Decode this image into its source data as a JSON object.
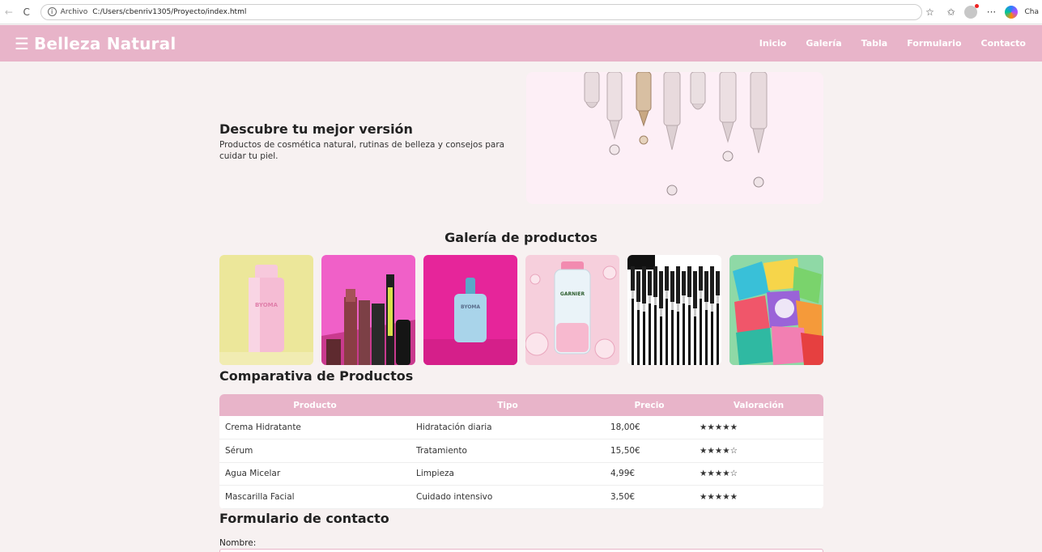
{
  "browser": {
    "scheme_label": "Archivo",
    "url": "C:/Users/cbenriv1305/Proyecto/index.html",
    "copilot_label": "Cha"
  },
  "header": {
    "brand": "Belleza Natural",
    "nav": [
      "Inicio",
      "Galería",
      "Tabla",
      "Formulario",
      "Contacto"
    ]
  },
  "hero": {
    "title": "Descubre tu mejor versión",
    "description": "Productos de cosmética natural, rutinas de belleza y consejos para cuidar tu piel."
  },
  "gallery": {
    "title": "Galería de productos",
    "items": [
      {
        "label": "BYOMA",
        "bg": "#ece79a"
      },
      {
        "label": "",
        "bg": "#f060c8"
      },
      {
        "label": "BYOMA",
        "bg": "#e6259a"
      },
      {
        "label": "GARNIER",
        "bg": "#f6cfdc"
      },
      {
        "label": "",
        "bg": "#ffffff"
      },
      {
        "label": "",
        "bg": "#6ed0c9"
      }
    ]
  },
  "table": {
    "title": "Comparativa de Productos",
    "headers": [
      "Producto",
      "Tipo",
      "Precio",
      "Valoración"
    ],
    "rows": [
      [
        "Crema Hidratante",
        "Hidratación diaria",
        "18,00€",
        "★★★★★"
      ],
      [
        "Sérum",
        "Tratamiento",
        "15,50€",
        "★★★★☆"
      ],
      [
        "Agua Micelar",
        "Limpieza",
        "4,99€",
        "★★★★☆"
      ],
      [
        "Mascarilla Facial",
        "Cuidado intensivo",
        "3,50€",
        "★★★★★"
      ]
    ]
  },
  "form": {
    "title": "Formulario de contacto",
    "name_label": "Nombre:"
  },
  "colors": {
    "accent": "#e8b4c9",
    "background": "#f7f1f1"
  }
}
